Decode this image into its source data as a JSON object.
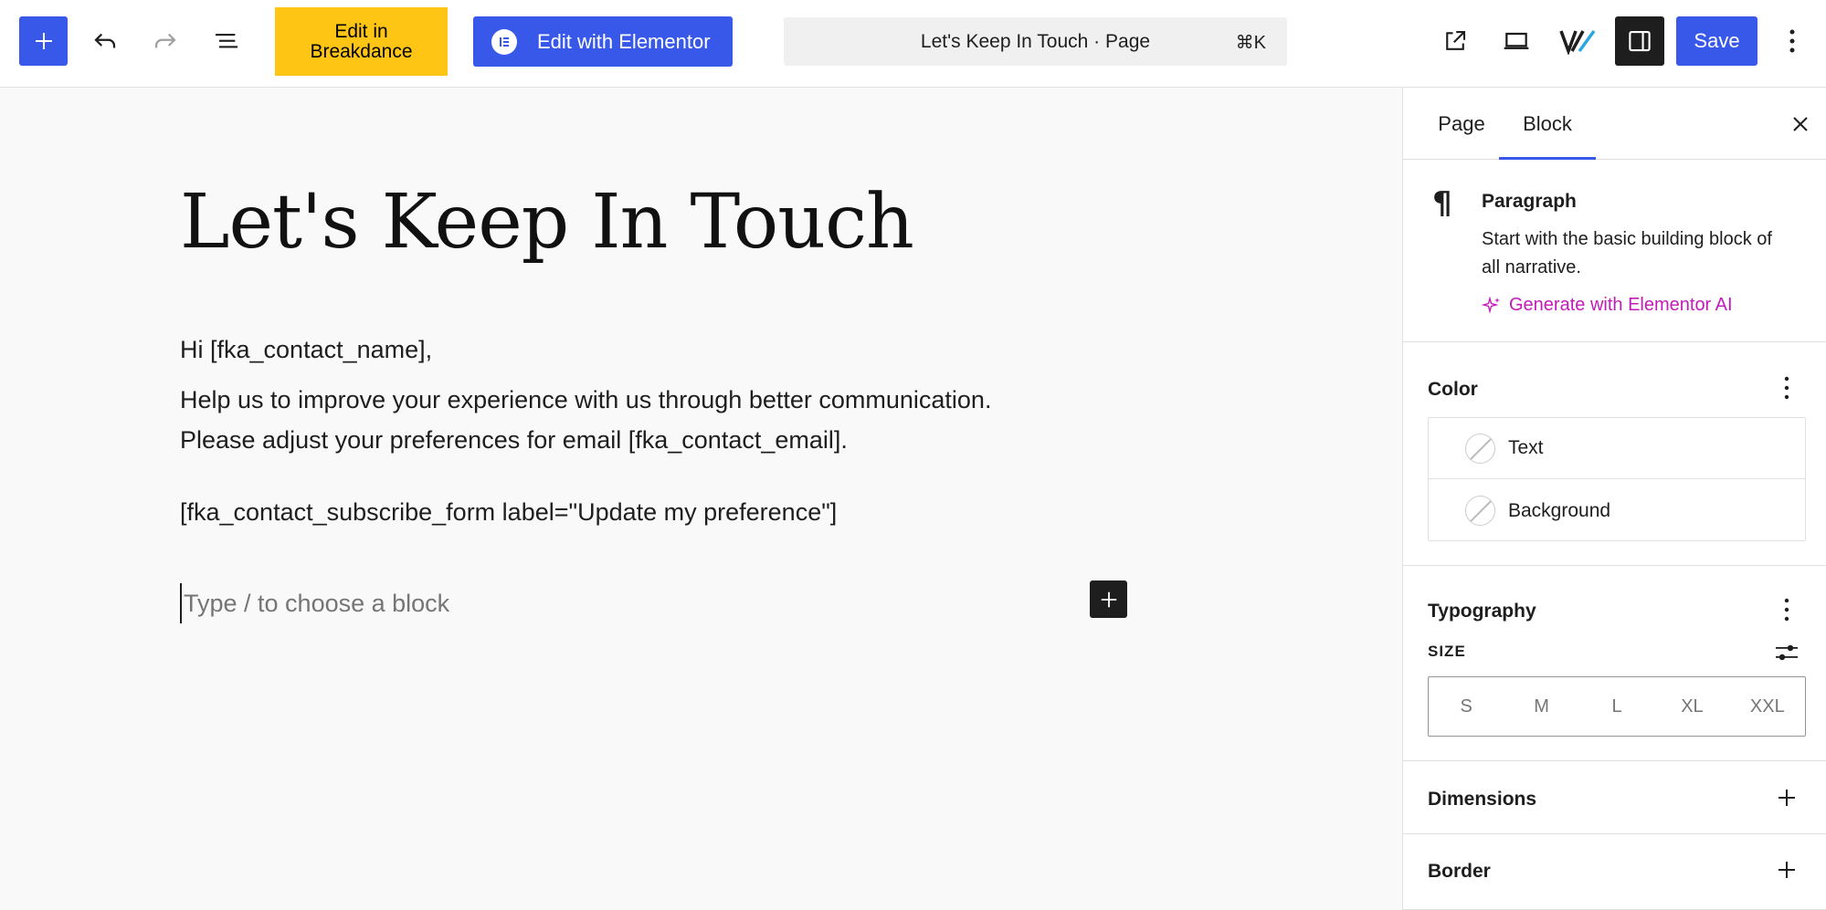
{
  "toolbar": {
    "breakdance_line1": "Edit in",
    "breakdance_line2": "Breakdance",
    "elementor_label": "Edit with Elementor",
    "command_title": "Let's Keep In Touch · Page",
    "command_shortcut": "⌘K",
    "save_label": "Save",
    "accent_color": "#3858e9",
    "breakdance_color": "#ffc514"
  },
  "editor": {
    "title": "Let's Keep In Touch",
    "paragraphs": [
      "Hi [fka_contact_name],",
      "Help us to improve your experience with us through better communication.",
      "Please adjust your preferences for email [fka_contact_email].",
      "[fka_contact_subscribe_form label=\"Update my preference\"]"
    ],
    "placeholder": "Type / to choose a block"
  },
  "sidebar": {
    "tabs": [
      {
        "label": "Page"
      },
      {
        "label": "Block"
      }
    ],
    "active_tab": "Block",
    "block": {
      "name": "Paragraph",
      "description": "Start with the basic building block of all narrative.",
      "ai_link": "Generate with Elementor AI",
      "ai_color": "#c21cb8"
    },
    "color": {
      "title": "Color",
      "items": [
        {
          "label": "Text"
        },
        {
          "label": "Background"
        }
      ]
    },
    "typography": {
      "title": "Typography",
      "size_label": "SIZE",
      "sizes": [
        "S",
        "M",
        "L",
        "XL",
        "XXL"
      ]
    },
    "dimensions": {
      "title": "Dimensions"
    },
    "border": {
      "title": "Border"
    }
  }
}
